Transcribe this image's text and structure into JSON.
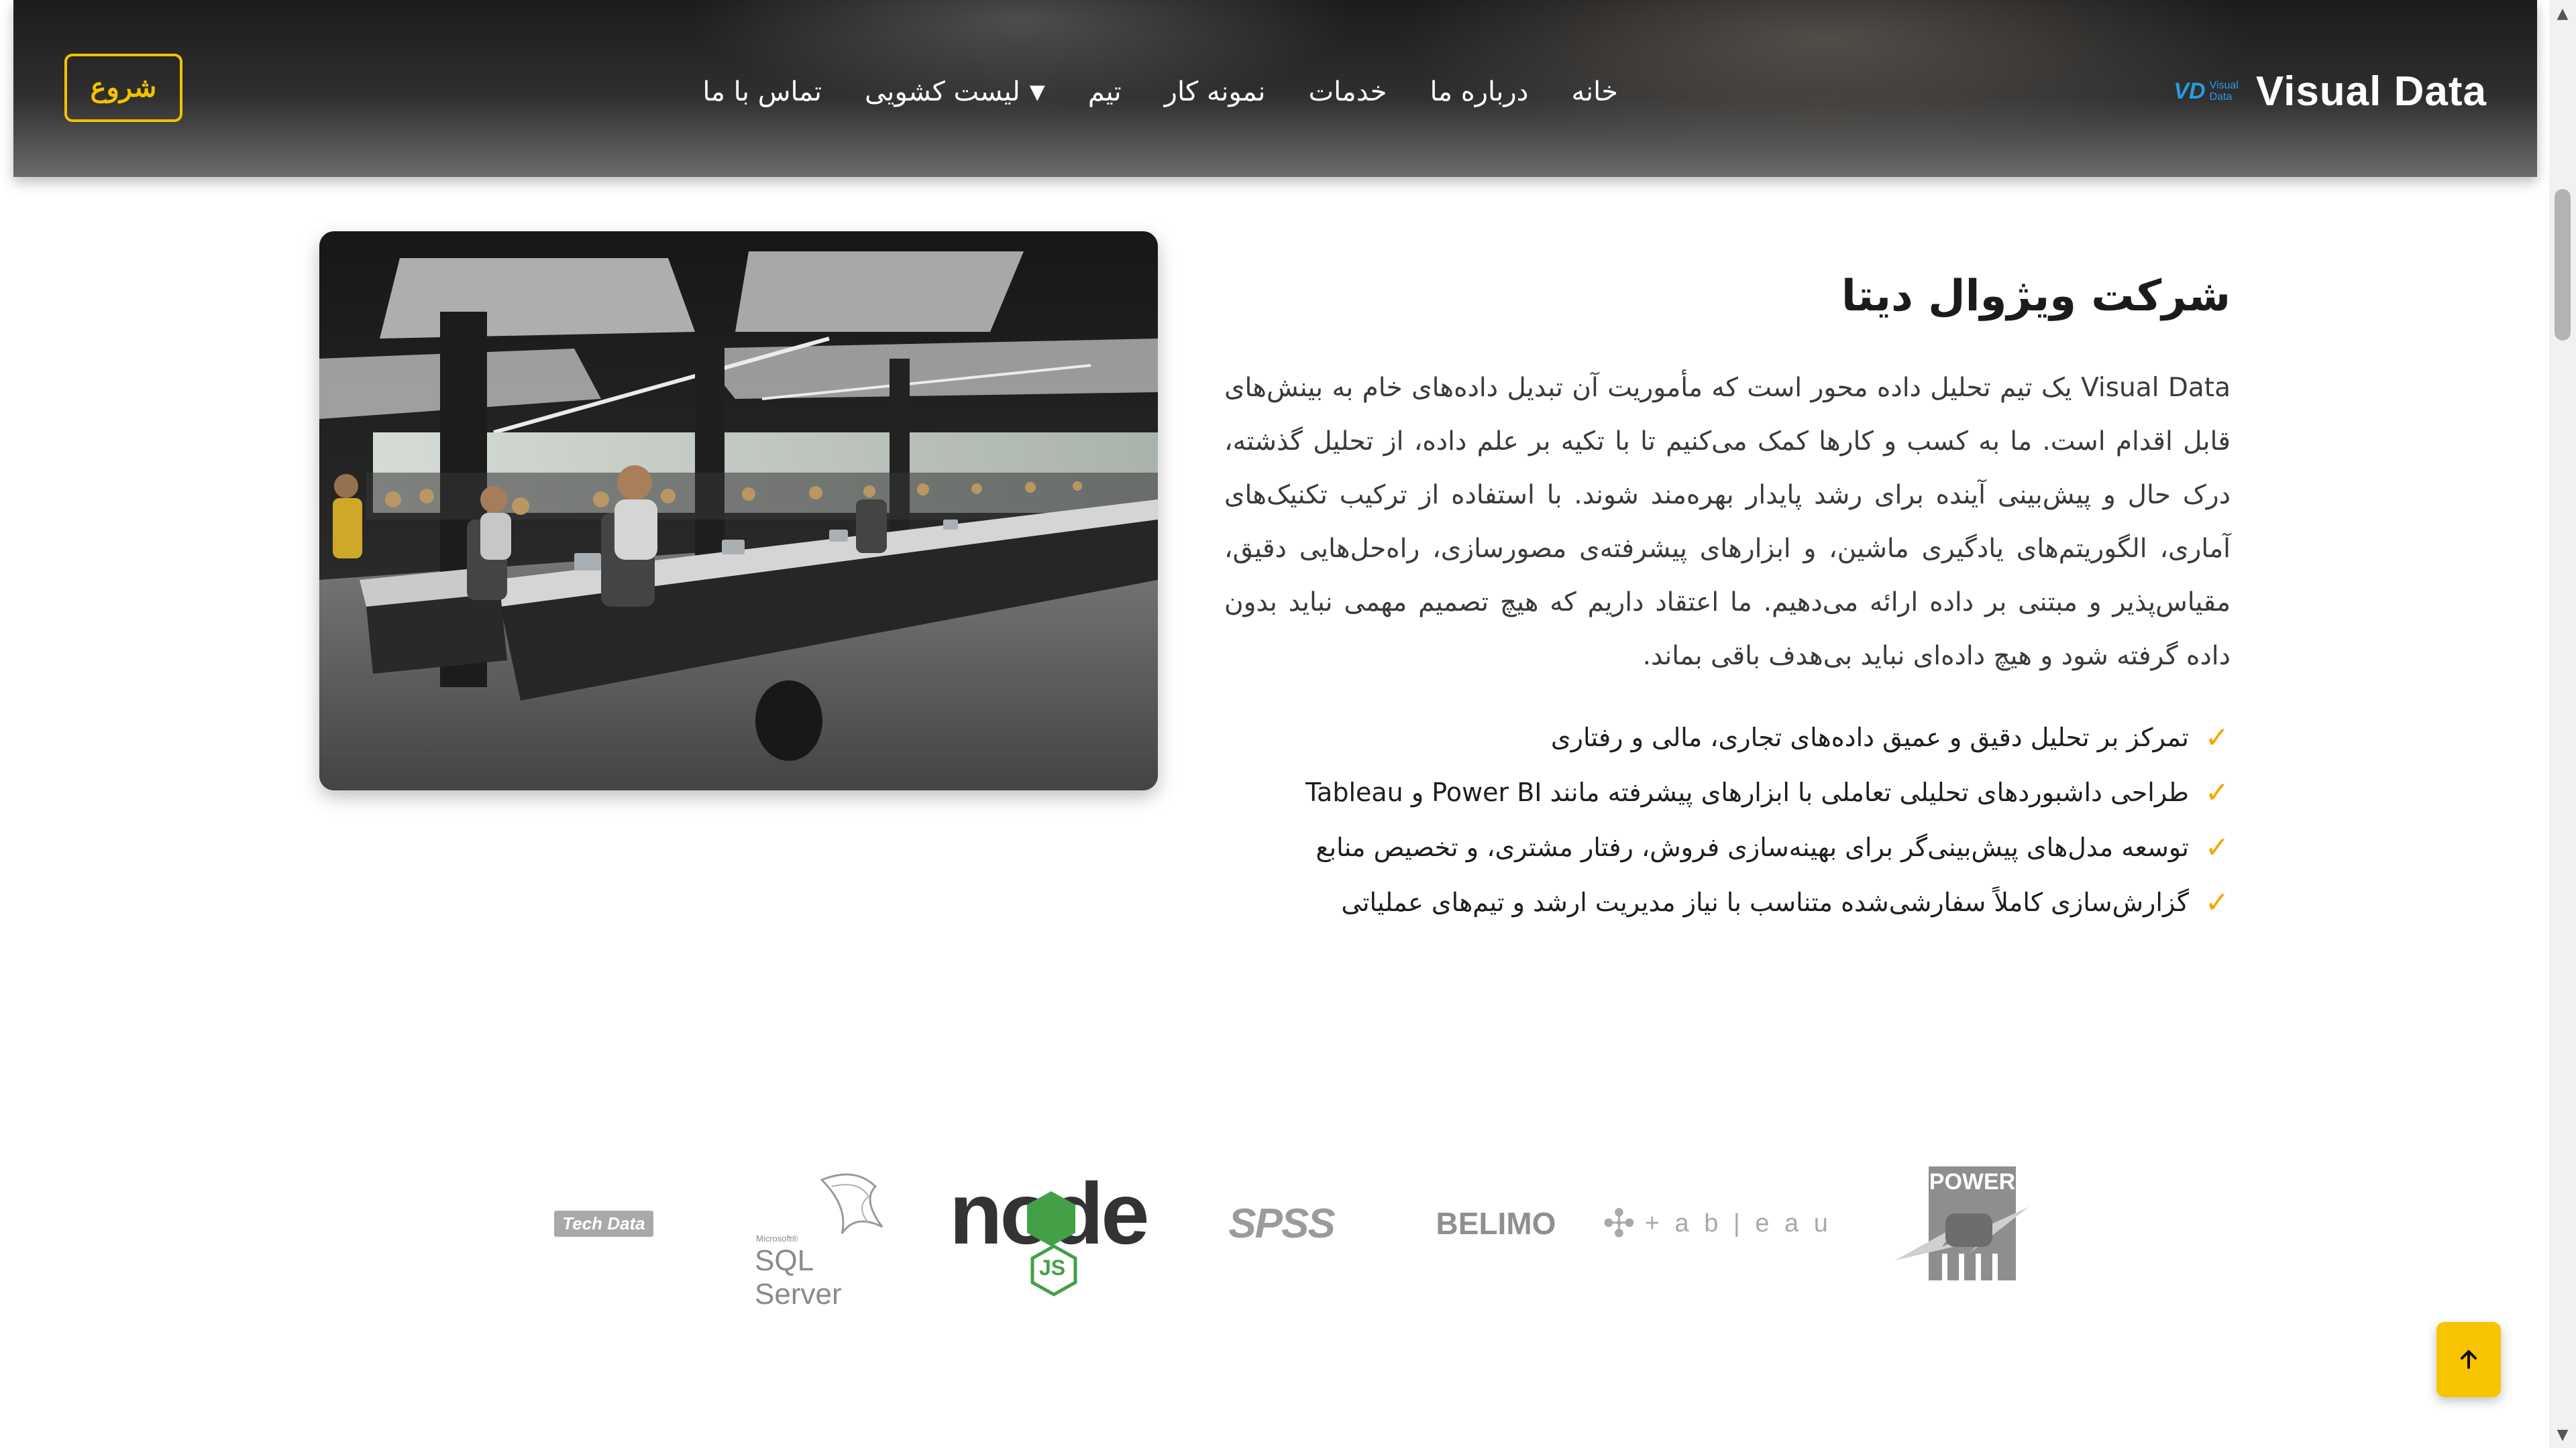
{
  "header": {
    "brand_name": "Visual Data",
    "brand_logo_mark": "VD",
    "brand_logo_line1": "Visual",
    "brand_logo_line2": "Data",
    "nav": [
      {
        "label": "خانه"
      },
      {
        "label": "درباره ما"
      },
      {
        "label": "خدمات"
      },
      {
        "label": "نمونه کار"
      },
      {
        "label": "تیم"
      },
      {
        "label": "لیست کشویی",
        "caret": "▼"
      },
      {
        "label": "تماس با ما"
      }
    ],
    "start_button": "شروع"
  },
  "about": {
    "title": "شرکت ویژوال دیتا",
    "body": "Visual Data یک تیم تحلیل داده محور است که مأموریت آن تبدیل داده‌های خام به بینش‌های قابل اقدام است. ما به کسب و کارها کمک می‌کنیم تا با تکیه بر علم داده، از تحلیل گذشته، درک حال و پیش‌بینی آینده برای رشد پایدار بهره‌مند شوند. با استفاده از ترکیب تکنیک‌های آماری، الگوریتم‌های یادگیری ماشین، و ابزارهای پیشرفته‌ی مصورسازی، راه‌حل‌هایی دقیق، مقیاس‌پذیر و مبتنی بر داده ارائه می‌دهیم. ما اعتقاد داریم که هیچ تصمیم مهمی نباید بدون داده گرفته شود و هیچ داده‌ای نباید بی‌هدف باقی بماند.",
    "check_glyph": "✓",
    "features": [
      "تمرکز بر تحلیل دقیق و عمیق داده‌های تجاری، مالی و رفتاری",
      "طراحی داشبوردهای تحلیلی تعاملی با ابزارهای پیشرفته مانند Power BI و Tableau",
      "توسعه مدل‌های پیش‌بینی‌گر برای بهینه‌سازی فروش، رفتار مشتری، و تخصیص منابع",
      "گزارش‌سازی کاملاً سفارشی‌شده متناسب با نیاز مدیریت ارشد و تیم‌های عملیاتی"
    ]
  },
  "logos": {
    "techdata": "Tech Data",
    "sqlserver_small": "Microsoft®",
    "sqlserver": "SQL Server",
    "node": "node",
    "node_js": "JS",
    "spss": "SPSS",
    "belimo": "BELIMO",
    "tableau": "+ a b | e a u",
    "power": "POWER"
  },
  "colors": {
    "accent": "#f2c200",
    "check": "#f2a900",
    "brand_blue": "#2a9be0",
    "node_green": "#43a047"
  },
  "icons": {
    "to_top": "arrow-up-icon",
    "check": "check-icon"
  }
}
